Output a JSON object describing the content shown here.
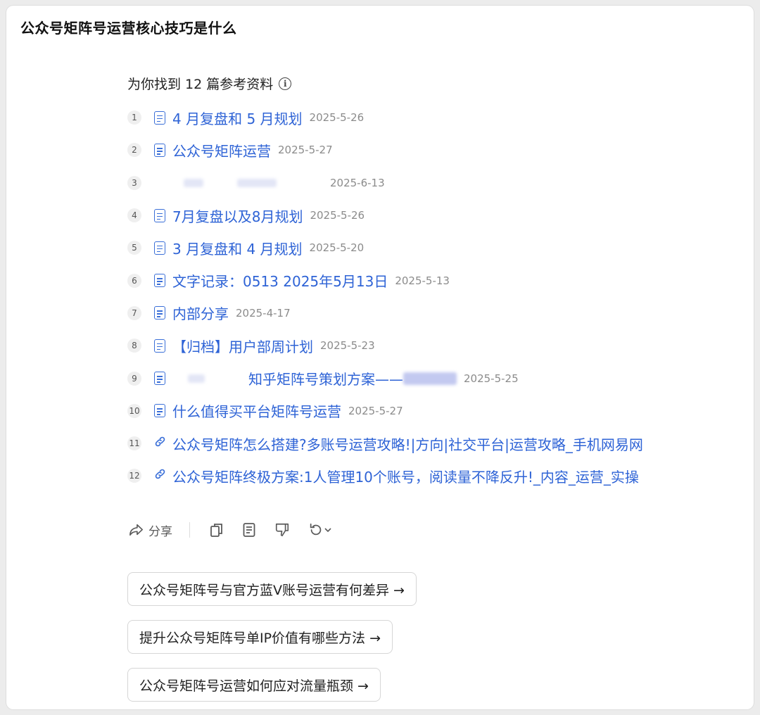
{
  "title": "公众号矩阵号运营核心技巧是什么",
  "references": {
    "heading": "为你找到 12 篇参考资料",
    "info_icon": "info-circle-icon",
    "items": [
      {
        "num": "1",
        "icon": "doc",
        "title": "4 月复盘和 5 月规划",
        "date": "2025-5-26"
      },
      {
        "num": "2",
        "icon": "doc",
        "title": "公众号矩阵运营",
        "date": "2025-5-27"
      },
      {
        "num": "3",
        "icon": "blurred",
        "title": "",
        "date": "2025-6-13"
      },
      {
        "num": "4",
        "icon": "doc",
        "title": "7月复盘以及8月规划",
        "date": "2025-5-26"
      },
      {
        "num": "5",
        "icon": "doc",
        "title": "3 月复盘和 4 月规划",
        "date": "2025-5-20"
      },
      {
        "num": "6",
        "icon": "doc",
        "title": "文字记录：0513 2025年5月13日",
        "date": "2025-5-13"
      },
      {
        "num": "7",
        "icon": "doc",
        "title": "内部分享",
        "date": "2025-4-17"
      },
      {
        "num": "8",
        "icon": "doc",
        "title": "【归档】用户部周计划",
        "date": "2025-5-23"
      },
      {
        "num": "9",
        "icon": "doc",
        "title": "知乎矩阵号策划方案——",
        "date": "2025-5-25"
      },
      {
        "num": "10",
        "icon": "doc",
        "title": "什么值得买平台矩阵号运营",
        "date": "2025-5-27"
      },
      {
        "num": "11",
        "icon": "link",
        "title": "公众号矩阵怎么搭建?多账号运营攻略!|方向|社交平台|运营攻略_手机网易网",
        "date": ""
      },
      {
        "num": "12",
        "icon": "link",
        "title": "公众号矩阵终极方案:1人管理10个账号，阅读量不降反升!_内容_运营_实操",
        "date": ""
      }
    ]
  },
  "actions": {
    "share_label": "分享",
    "icons": [
      "share-icon",
      "copy-icon",
      "document-icon",
      "thumbs-down-icon",
      "regenerate-icon",
      "chevron-down-icon"
    ]
  },
  "suggestions": [
    "公众号矩阵号与官方蓝V账号运营有何差异 →",
    "提升公众号矩阵号单IP价值有哪些方法 →",
    "公众号矩阵号运营如何应对流量瓶颈 →"
  ],
  "colors": {
    "link": "#2e63d6",
    "date": "#8b8b8b"
  }
}
